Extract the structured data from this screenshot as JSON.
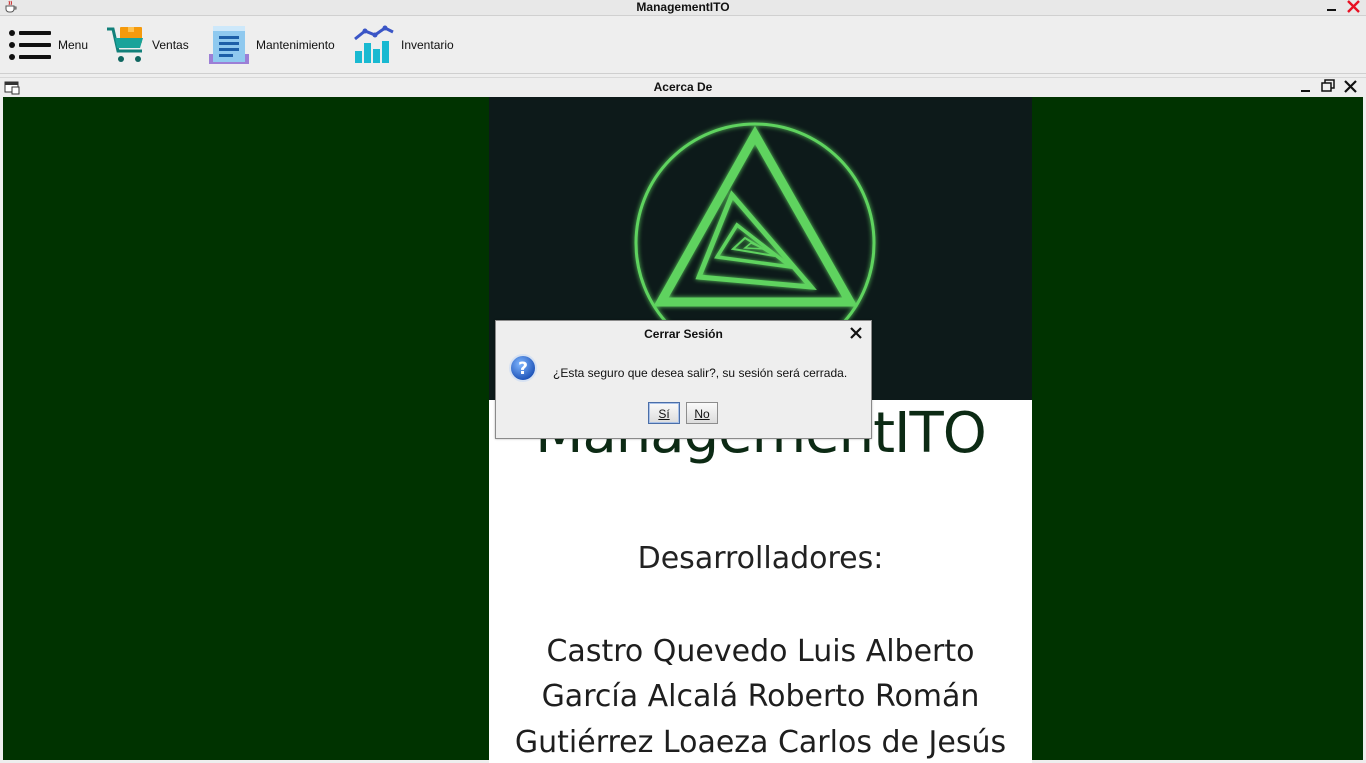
{
  "app": {
    "title": "ManagementITO"
  },
  "toolbar": {
    "items": [
      {
        "label": "Menu",
        "icon": "hamburger-menu-icon"
      },
      {
        "label": "Ventas",
        "icon": "shopping-cart-icon"
      },
      {
        "label": "Mantenimiento",
        "icon": "document-list-icon"
      },
      {
        "label": "Inventario",
        "icon": "bar-chart-icon"
      }
    ]
  },
  "internal_frame": {
    "title": "Acerca De",
    "poster": {
      "brand": "ManagementITO",
      "heading": "Desarrolladores:",
      "developers": [
        "Castro Quevedo Luis Alberto",
        "García Alcalá Roberto Román",
        "Gutiérrez Loaeza Carlos de Jesús"
      ]
    }
  },
  "dialog": {
    "title": "Cerrar Sesión",
    "message": "¿Esta seguro que desea salir?, su sesión será cerrada.",
    "yes_label": "Sí",
    "no_label": "No"
  },
  "colors": {
    "background_green": "#003300",
    "logo_green": "#5fd35f",
    "close_red": "#e81123"
  }
}
